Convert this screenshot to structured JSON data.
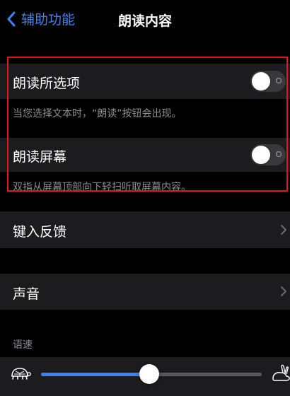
{
  "nav": {
    "back_label": "辅助功能",
    "title": "朗读内容"
  },
  "speak_selection": {
    "label": "朗读所选项",
    "enabled": false,
    "footnote": "当您选择文本时，“朗读”按钮会出现。"
  },
  "speak_screen": {
    "label": "朗读屏幕",
    "enabled": false,
    "footnote": "双指从屏幕顶部向下轻扫听取屏幕内容。"
  },
  "typing_feedback": {
    "label": "键入反馈"
  },
  "voices": {
    "label": "声音"
  },
  "speaking_rate": {
    "label": "语速",
    "value_fraction": 0.49,
    "slow_icon": "tortoise-icon",
    "fast_icon": "hare-icon"
  },
  "colors": {
    "accent": "#3b82f6",
    "highlight": "#e0161b",
    "cell": "#1c1c1e",
    "footnote": "#8e8e93"
  }
}
